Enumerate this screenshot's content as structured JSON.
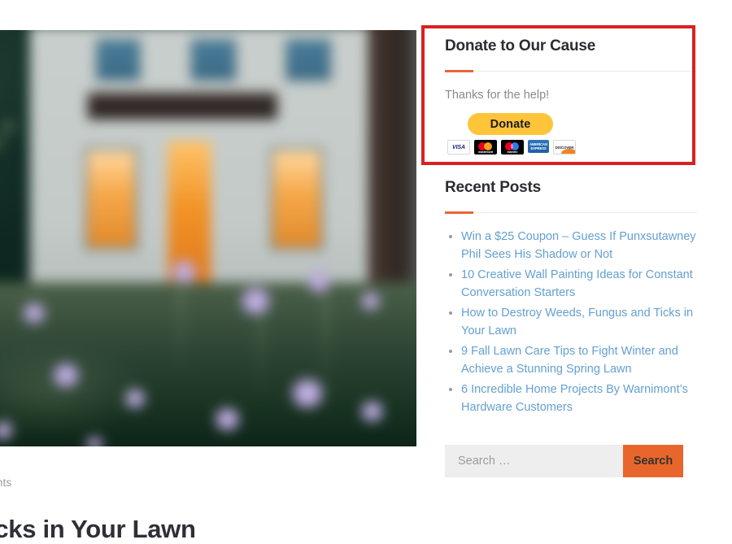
{
  "colors": {
    "accent_orange": "#e8663a",
    "search_button": "#e8662c",
    "link_blue": "#64a0d0",
    "heading_dark": "#2b2d33",
    "highlight_red": "#d92121",
    "paypal_yellow": "#ffc439"
  },
  "post": {
    "meta": "omments",
    "title": "Fungus and Ticks in Your Lawn",
    "image_alt": "Blurred photo of a house at dusk with lit windows behind a meadow of purple flowers"
  },
  "sidebar": {
    "donate": {
      "title": "Donate to Our Cause",
      "text": "Thanks for the help!",
      "button_label": "Donate",
      "cards": [
        {
          "name": "visa-card-icon",
          "label": "VISA"
        },
        {
          "name": "mastercard-card-icon",
          "label": "mastercard"
        },
        {
          "name": "maestro-card-icon",
          "label": "maestro"
        },
        {
          "name": "amex-card-icon",
          "label": "AMERICAN EXPRESS"
        },
        {
          "name": "discover-card-icon",
          "label": "DISCOVER"
        }
      ]
    },
    "recent": {
      "title": "Recent Posts",
      "items": [
        "Win a $25 Coupon – Guess If Punxsutawney Phil Sees His Shadow or Not",
        "10 Creative Wall Painting Ideas for Constant Conversation Starters",
        "How to Destroy Weeds, Fungus and Ticks in Your Lawn",
        "9 Fall Lawn Care Tips to Fight Winter and Achieve a Stunning Spring Lawn",
        "6 Incredible Home Projects By Warnimont’s Hardware Customers"
      ]
    },
    "search": {
      "placeholder": "Search …",
      "value": "",
      "button_label": "Search"
    }
  }
}
